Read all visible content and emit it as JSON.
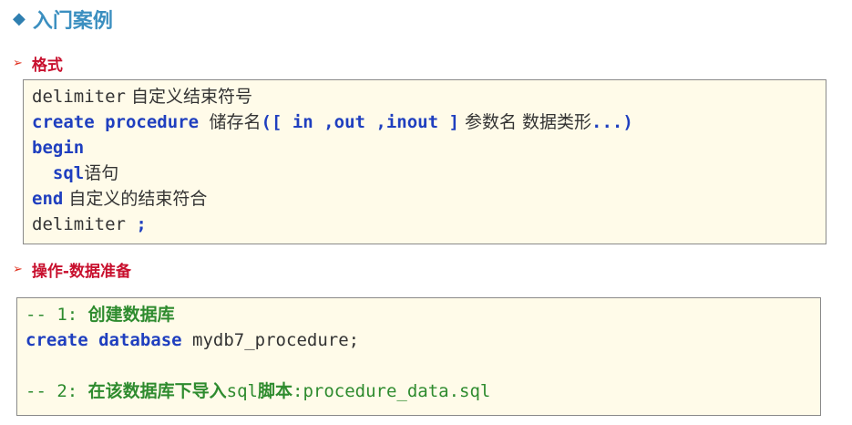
{
  "title": {
    "diamond": "◆",
    "text": "入门案例"
  },
  "bullets": {
    "arrow": "➢",
    "format": "格式",
    "prepare": "操作-数据准备"
  },
  "format_code": {
    "l1": {
      "kw": "delimiter",
      "text": " 自定义结束符号"
    },
    "l2": {
      "kw1": "create",
      "kw2": "procedure",
      "name": "储存名",
      "open": "([ ",
      "in": "in",
      "c1": " ,",
      "out": "out",
      "c2": " ,",
      "inout": "inout",
      "close": " ]",
      "params": " 参数名 数据类形",
      "end": "...)"
    },
    "l3": {
      "kw": "begin"
    },
    "l4": {
      "indent": "  ",
      "kw": "sql",
      "text": "语句"
    },
    "l5": {
      "kw": "end",
      "text": " 自定义的结束符合"
    },
    "l6": {
      "kw": "delimiter",
      "semi": " ;"
    }
  },
  "prep_code": {
    "l1": {
      "prefix": "-- 1: ",
      "text": "创建数据库"
    },
    "l2": {
      "kw1": "create",
      "kw2": "database",
      "text": " mydb7_procedure;"
    },
    "l4": {
      "prefix": "-- 2: ",
      "text1": "在该数据库下导入",
      "sql": "sql",
      "text2": "脚本",
      "file": ":procedure_data.sql"
    }
  }
}
